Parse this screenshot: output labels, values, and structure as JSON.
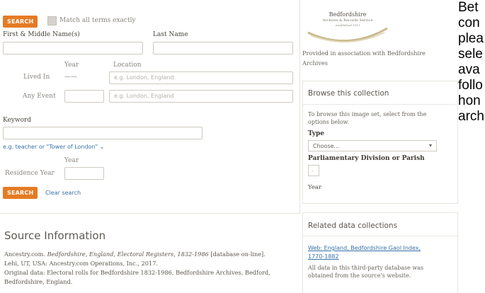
{
  "search": {
    "search_button": "SEARCH",
    "match_all_label": "Match all terms exactly",
    "first_middle_label": "First & Middle Name(s)",
    "last_name_label": "Last Name",
    "year_label": "Year",
    "location_label": "Location",
    "lived_in_label": "Lived In",
    "lived_in_year_value": "——",
    "lived_in_location_placeholder": "e.g. London, England",
    "any_event_label": "Any Event",
    "any_event_location_placeholder": "e.g. London, England",
    "keyword_label": "Keyword",
    "keyword_hint": "e.g. teacher or \"Tower of London\"",
    "year_label_2": "Year",
    "residence_year_label": "Residence Year",
    "search_button_2": "SEARCH",
    "clear_search": "Clear search"
  },
  "source": {
    "title": "Source Information",
    "line1_pre": "Ancestry.com. ",
    "line1_em": "Bedfordshire, England, Electoral Registers, 1832-1986",
    "line1_post": " [database on-line].",
    "line2": "Lehi, UT, USA: Ancestry.com Operations, Inc., 2017.",
    "line3": "Original data: Electoral rolls for Bedfordshire 1832-1986, Bedfordshire Archives, Bedford,",
    "line4": "Bedfordshire, England."
  },
  "partner": {
    "logo_title": "Bedfordshire",
    "logo_sub": "Archives & Records Service",
    "logo_est": "established 1913",
    "provided_text": "Provided in association with Bedfordshire",
    "provided_text_2": "Archives"
  },
  "browse": {
    "title": "Browse this collection",
    "intro": "To browse this image set, select from the",
    "intro_2": "options below.",
    "type_label": "Type",
    "type_value": "Choose...",
    "division_label": "Parliamentary Division or Parish",
    "division_value": "-",
    "year_label": "Year"
  },
  "related": {
    "title": "Related data collections",
    "link": "Web: England, Bedfordshire Gaol Index,",
    "link_2": "1770-1882",
    "desc": "All data in this third-party database was",
    "desc_2": "obtained from the source's website."
  },
  "overflow": [
    "Bet",
    "con",
    "plea",
    "sele",
    "ava",
    "follo",
    "hon",
    "arch"
  ],
  "colors": {
    "accent": "#e57b24",
    "link": "#3771a8"
  }
}
